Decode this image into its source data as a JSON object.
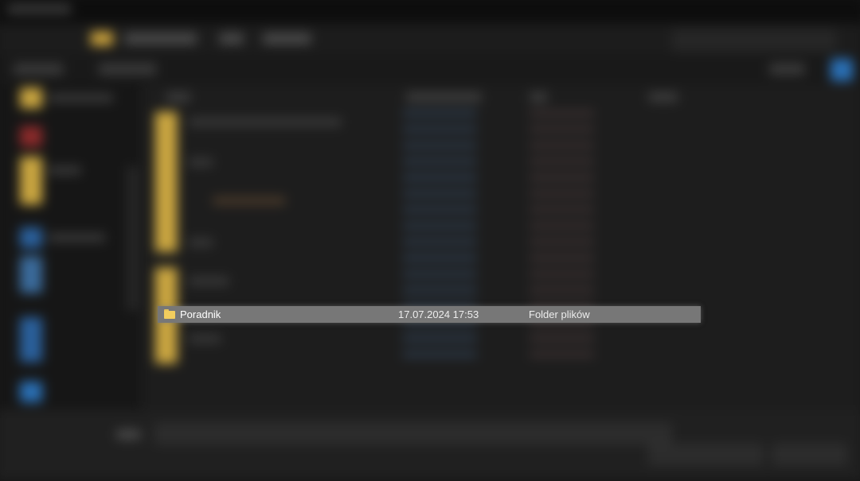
{
  "file_list": {
    "selected_row": {
      "name": "Poradnik",
      "date_modified": "17.07.2024 17:53",
      "type": "Folder plików",
      "icon": "folder-icon"
    }
  },
  "colors": {
    "selection": "#777777",
    "folder": "#f2cd5e",
    "background": "#1d1d1d"
  }
}
